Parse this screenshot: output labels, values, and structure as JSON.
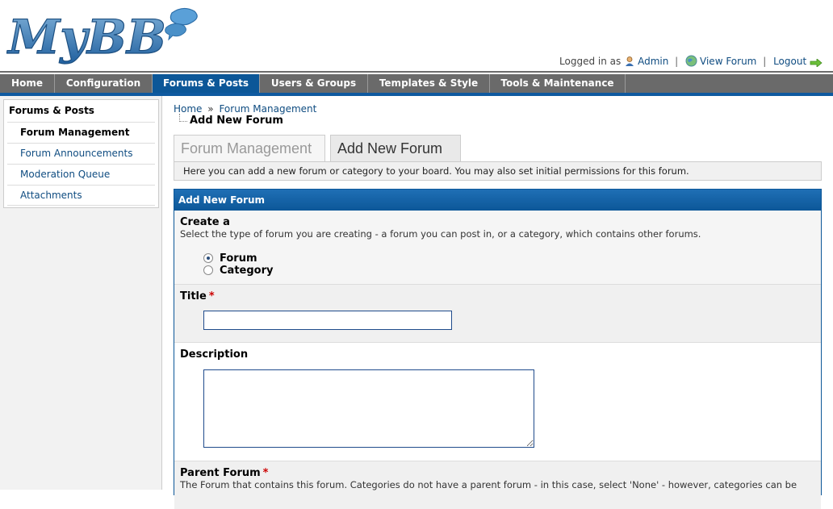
{
  "header": {
    "logo_text": "MyBB",
    "logged_in_as": "Logged in as",
    "user_name": "Admin",
    "view_forum": "View Forum",
    "logout": "Logout",
    "sep": "|"
  },
  "menu": {
    "tabs": [
      {
        "label": "Home"
      },
      {
        "label": "Configuration"
      },
      {
        "label": "Forums & Posts"
      },
      {
        "label": "Users & Groups"
      },
      {
        "label": "Templates & Style"
      },
      {
        "label": "Tools & Maintenance"
      }
    ],
    "active": "Forums & Posts"
  },
  "sidebar": {
    "title": "Forums & Posts",
    "items": [
      {
        "label": "Forum Management"
      },
      {
        "label": "Forum Announcements"
      },
      {
        "label": "Moderation Queue"
      },
      {
        "label": "Attachments"
      }
    ]
  },
  "main": {
    "breadcrumb": [
      "Home",
      "Forum Management"
    ],
    "breadcrumb_sep": "»",
    "page_title": "Add New Forum",
    "subtabs": [
      {
        "label": "Forum Management"
      },
      {
        "label": "Add New Forum"
      }
    ],
    "notice": "Here you can add a new forum or category to your board. You may also set initial permissions for this forum.",
    "form": {
      "header": "Add New Forum",
      "type": {
        "label": "Create a",
        "desc": "Select the type of forum you are creating - a forum you can post in, or a category, which contains other forums.",
        "options": [
          "Forum",
          "Category"
        ],
        "selected": "Forum"
      },
      "title": {
        "label": "Title",
        "required": "*",
        "value": ""
      },
      "description": {
        "label": "Description",
        "value": ""
      },
      "parent": {
        "label": "Parent Forum",
        "required": "*",
        "desc": "The Forum that contains this forum. Categories do not have a parent forum - in this case, select 'None' - however, categories can be"
      }
    }
  },
  "colors": {
    "menu_bg": "#6a6a6a",
    "menu_active": "#0c5798",
    "link": "#0f4c81",
    "required": "#cc0000"
  }
}
